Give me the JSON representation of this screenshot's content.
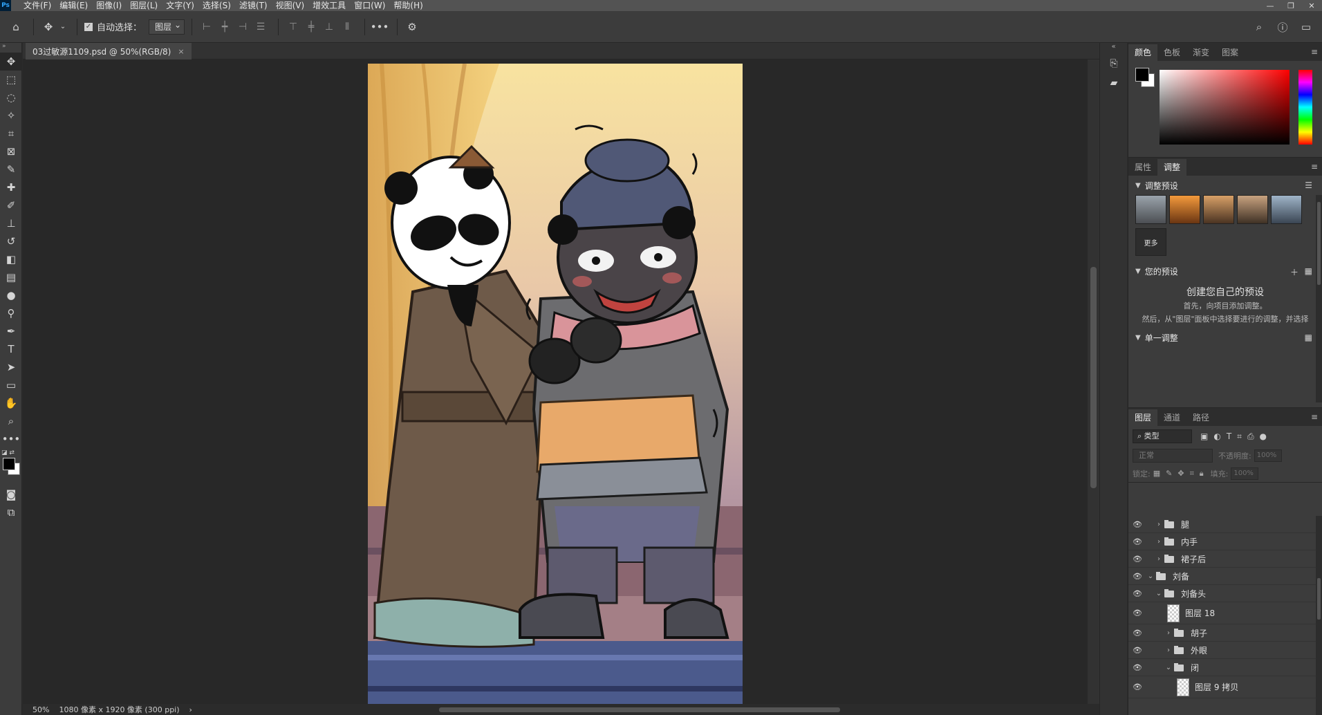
{
  "app": {
    "logo": "Ps",
    "menu": [
      "文件(F)",
      "编辑(E)",
      "图像(I)",
      "图层(L)",
      "文字(Y)",
      "选择(S)",
      "滤镜(T)",
      "视图(V)",
      "增效工具",
      "窗口(W)",
      "帮助(H)"
    ],
    "window_controls": [
      "—",
      "❐",
      "✕"
    ]
  },
  "options_bar": {
    "auto_select_label": "自动选择：",
    "auto_select_checked": true,
    "target_select": "图层"
  },
  "document": {
    "tab_title": "03过敏源1109.psd @ 50%(RGB/8)",
    "close_glyph": "×"
  },
  "status": {
    "zoom": "50%",
    "doc_info": "1080 像素 x 1920 像素 (300 ppi)",
    "arrow": "›"
  },
  "panels": {
    "color_tabs": [
      "颜色",
      "色板",
      "渐变",
      "图案"
    ],
    "color_active": 0,
    "colors": {
      "foreground": "#000000",
      "background": "#ffffff"
    },
    "adj_tabs": [
      "属性",
      "调整"
    ],
    "adj_active": 1,
    "adjust_presets_title": "调整预设",
    "more_label": "更多",
    "your_presets_title": "您的预设",
    "create_title": "创建您自己的预设",
    "create_line1": "首先，向项目添加调整。",
    "create_line2": "然后，从\"图层\"面板中选择要进行的调整，并选择",
    "single_adjust_title": "单一调整",
    "layers_tabs": [
      "图层",
      "通道",
      "路径"
    ],
    "layers_active": 0,
    "filter_type": "类型",
    "blend_mode": "正常",
    "opacity_label": "不透明度:",
    "opacity_value": "100%",
    "lock_label": "锁定:",
    "fill_label": "填充:",
    "fill_value": "100%"
  },
  "layers": [
    {
      "name": "腿",
      "type": "folder",
      "indent": 0,
      "expanded": false
    },
    {
      "name": "内手",
      "type": "folder",
      "indent": 0,
      "expanded": false
    },
    {
      "name": "裙子后",
      "type": "folder",
      "indent": 0,
      "expanded": false
    },
    {
      "name": "刘备",
      "type": "folder",
      "indent": -1,
      "expanded": true
    },
    {
      "name": "刘备头",
      "type": "folder",
      "indent": 0,
      "expanded": true
    },
    {
      "name": "图层 18",
      "type": "pixel",
      "indent": 1
    },
    {
      "name": "胡子",
      "type": "folder",
      "indent": 1,
      "expanded": false
    },
    {
      "name": "外眼",
      "type": "folder",
      "indent": 1,
      "expanded": false
    },
    {
      "name": "闭",
      "type": "folder",
      "indent": 1,
      "expanded": true
    },
    {
      "name": "图层 9 拷贝",
      "type": "pixel",
      "indent": 2
    }
  ]
}
